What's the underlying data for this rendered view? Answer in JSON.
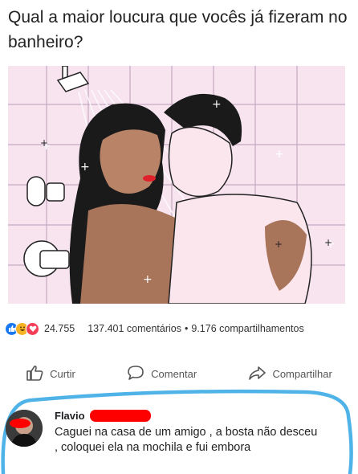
{
  "post": {
    "text": "Qual a maior loucura que vocês já fizeram no banheiro?"
  },
  "reactions": {
    "icons": [
      "like-icon",
      "haha-icon",
      "love-icon"
    ],
    "count": "24.755",
    "comments": "137.401 comentários",
    "separator": "•",
    "shares": "9.176 compartilhamentos"
  },
  "actions": {
    "like": "Curtir",
    "comment": "Comentar",
    "share": "Compartilhar"
  },
  "comment": {
    "author": "Flavio",
    "body": "Caguei na casa de um amigo , a bosta não desceu , coloquei ela na mochila e fui embora"
  },
  "colors": {
    "like": "#1877f2",
    "haha": "#f7b125",
    "love": "#f33e58",
    "highlight": "#4fb3e8",
    "redaction": "#ff0000",
    "tile_bg": "#f7e4ef"
  }
}
